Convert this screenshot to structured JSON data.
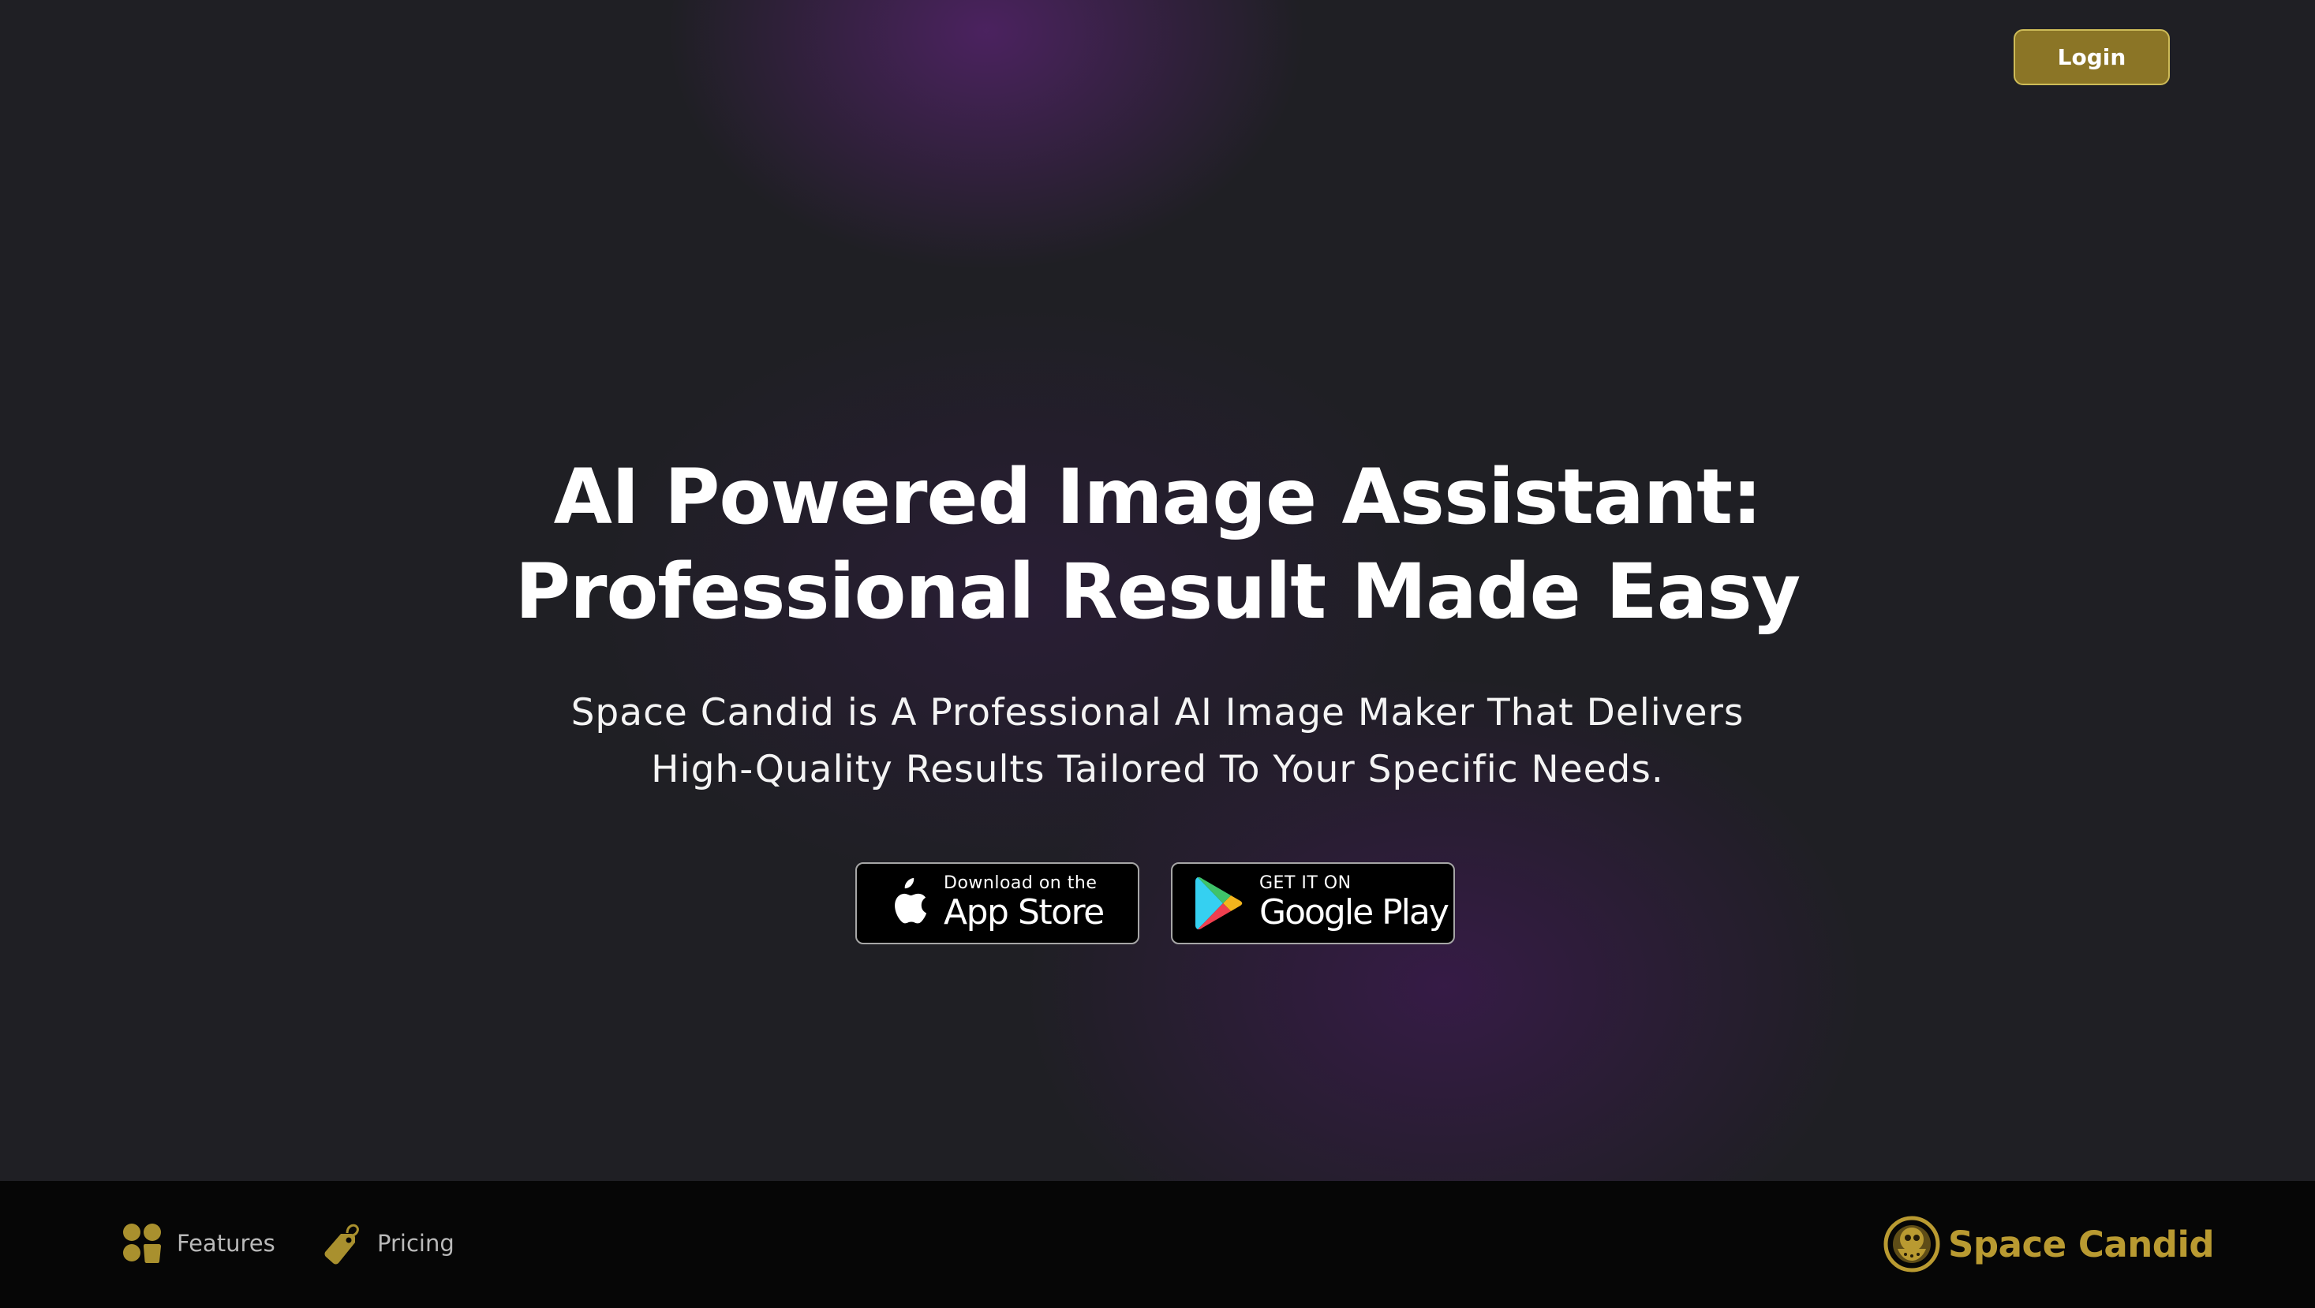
{
  "header": {
    "login_label": "Login"
  },
  "hero": {
    "headline_line1": "AI Powered Image Assistant:",
    "headline_line2": "Professional Result Made Easy",
    "subheadline_line1": "Space Candid is A Professional AI Image Maker That Delivers",
    "subheadline_line2": "High-Quality Results Tailored To Your Specific Needs.",
    "app_store": {
      "icon": "apple-icon",
      "small_text": "Download on the",
      "large_text": "App Store"
    },
    "google_play": {
      "icon": "google-play-icon",
      "small_text": "GET IT ON",
      "large_text": "Google Play"
    }
  },
  "footer": {
    "nav_items": [
      {
        "icon": "features-icon",
        "label": "Features"
      },
      {
        "icon": "price-tag-icon",
        "label": "Pricing"
      }
    ],
    "brand": {
      "icon": "space-candid-logo-icon",
      "name": "Space Candid"
    }
  },
  "colors": {
    "background": "#1f1f24",
    "accent_gold": "#b99a31",
    "login_button": "#8b7526",
    "footer_background": "#060606",
    "purple_glow": "#5c2476"
  }
}
